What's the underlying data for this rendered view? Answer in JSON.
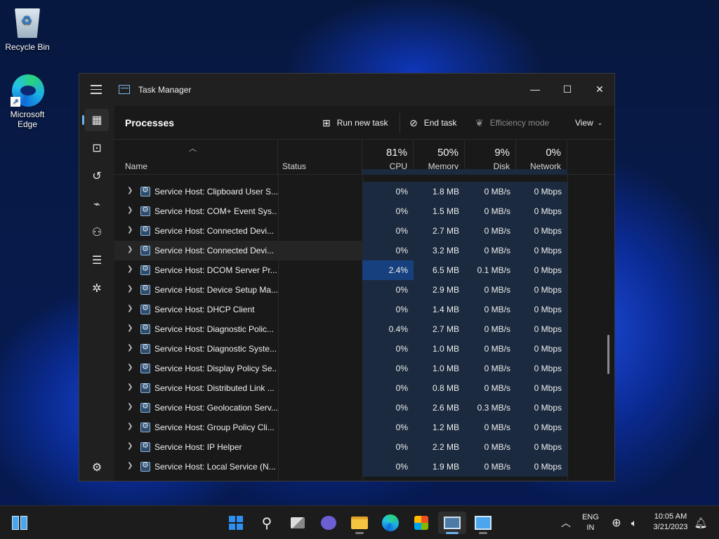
{
  "desktop": {
    "icons": [
      {
        "label": "Recycle Bin"
      },
      {
        "label": "Microsoft Edge"
      }
    ]
  },
  "window": {
    "title": "Task Manager",
    "controls": {
      "minimize": "—",
      "maximize": "☐",
      "close": "✕"
    }
  },
  "toolbar": {
    "page_title": "Processes",
    "run_new_task": "Run new task",
    "end_task": "End task",
    "efficiency_mode": "Efficiency mode",
    "view": "View"
  },
  "columns": {
    "name": "Name",
    "status": "Status",
    "cpu": {
      "pct": "81%",
      "label": "CPU"
    },
    "memory": {
      "pct": "50%",
      "label": "Memory"
    },
    "disk": {
      "pct": "9%",
      "label": "Disk"
    },
    "network": {
      "pct": "0%",
      "label": "Network"
    }
  },
  "processes": [
    {
      "name": "Service Host: Clipboard User S...",
      "cpu": "0%",
      "memory": "1.8 MB",
      "disk": "0 MB/s",
      "network": "0 Mbps"
    },
    {
      "name": "Service Host: COM+ Event Sys...",
      "cpu": "0%",
      "memory": "1.5 MB",
      "disk": "0 MB/s",
      "network": "0 Mbps"
    },
    {
      "name": "Service Host: Connected Devi...",
      "cpu": "0%",
      "memory": "2.7 MB",
      "disk": "0 MB/s",
      "network": "0 Mbps"
    },
    {
      "name": "Service Host: Connected Devi...",
      "cpu": "0%",
      "memory": "3.2 MB",
      "disk": "0 MB/s",
      "network": "0 Mbps"
    },
    {
      "name": "Service Host: DCOM Server Pr...",
      "cpu": "2.4%",
      "memory": "6.5 MB",
      "disk": "0.1 MB/s",
      "network": "0 Mbps"
    },
    {
      "name": "Service Host: Device Setup Ma...",
      "cpu": "0%",
      "memory": "2.9 MB",
      "disk": "0 MB/s",
      "network": "0 Mbps"
    },
    {
      "name": "Service Host: DHCP Client",
      "cpu": "0%",
      "memory": "1.4 MB",
      "disk": "0 MB/s",
      "network": "0 Mbps"
    },
    {
      "name": "Service Host: Diagnostic Polic...",
      "cpu": "0.4%",
      "memory": "2.7 MB",
      "disk": "0 MB/s",
      "network": "0 Mbps"
    },
    {
      "name": "Service Host: Diagnostic Syste...",
      "cpu": "0%",
      "memory": "1.0 MB",
      "disk": "0 MB/s",
      "network": "0 Mbps"
    },
    {
      "name": "Service Host: Display Policy Se...",
      "cpu": "0%",
      "memory": "1.0 MB",
      "disk": "0 MB/s",
      "network": "0 Mbps"
    },
    {
      "name": "Service Host: Distributed Link ...",
      "cpu": "0%",
      "memory": "0.8 MB",
      "disk": "0 MB/s",
      "network": "0 Mbps"
    },
    {
      "name": "Service Host: Geolocation Serv...",
      "cpu": "0%",
      "memory": "2.6 MB",
      "disk": "0.3 MB/s",
      "network": "0 Mbps"
    },
    {
      "name": "Service Host: Group Policy Cli...",
      "cpu": "0%",
      "memory": "1.2 MB",
      "disk": "0 MB/s",
      "network": "0 Mbps"
    },
    {
      "name": "Service Host: IP Helper",
      "cpu": "0%",
      "memory": "2.2 MB",
      "disk": "0 MB/s",
      "network": "0 Mbps"
    },
    {
      "name": "Service Host: Local Service (N...",
      "cpu": "0%",
      "memory": "1.9 MB",
      "disk": "0 MB/s",
      "network": "0 Mbps"
    }
  ],
  "taskbar": {
    "tray": {
      "language": "ENG",
      "region": "IN",
      "time": "10:05 AM",
      "date": "3/21/2023"
    }
  },
  "colors": {
    "accent": "#6ab4f0",
    "window_bg": "#202020",
    "heat_cell": "#1b2a3f",
    "heat_cell_hot": "#17417e"
  }
}
